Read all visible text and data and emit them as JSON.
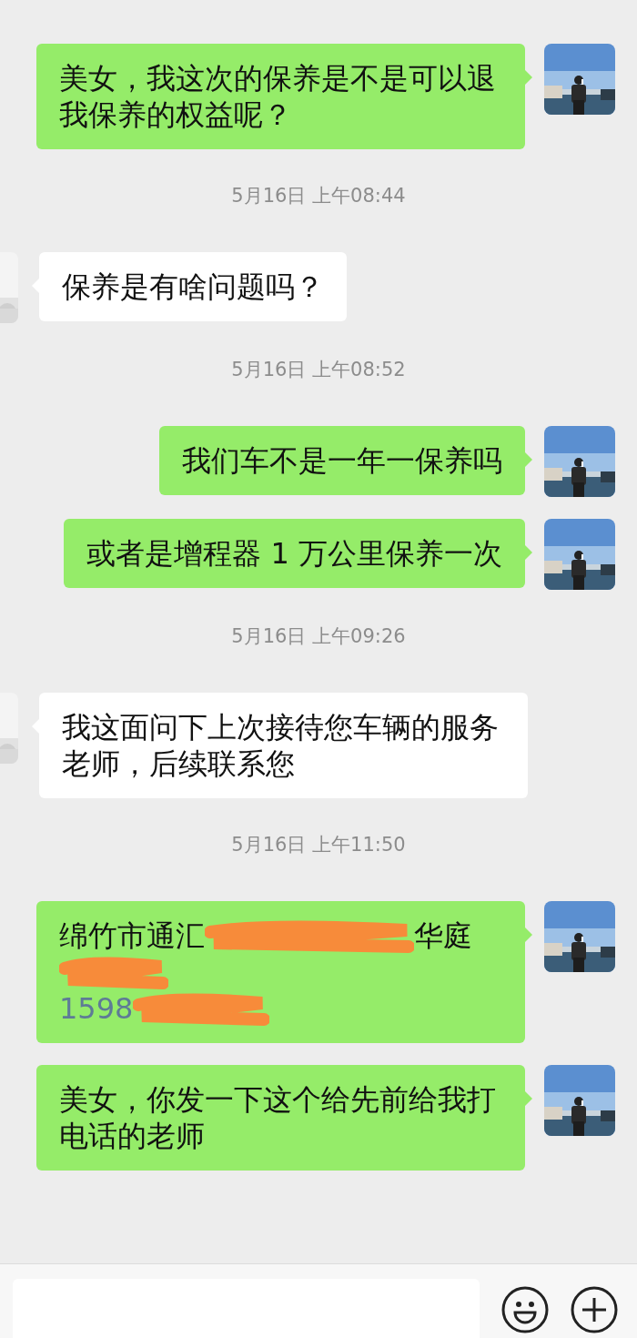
{
  "messages": [
    {
      "kind": "text",
      "outgoing": true,
      "text": "美女，我这次的保养是不是可以退我保养的权益呢？"
    },
    {
      "kind": "time",
      "text": "5月16日 上午08:44"
    },
    {
      "kind": "text",
      "outgoing": false,
      "text": "保养是有啥问题吗？"
    },
    {
      "kind": "time",
      "text": "5月16日 上午08:52"
    },
    {
      "kind": "text",
      "outgoing": true,
      "text": "我们车不是一年一保养吗"
    },
    {
      "kind": "text",
      "outgoing": true,
      "text": "或者是增程器 1 万公里保养一次"
    },
    {
      "kind": "time",
      "text": "5月16日 上午09:26"
    },
    {
      "kind": "text",
      "outgoing": false,
      "text": "我这面问下上次接待您车辆的服务老师，后续联系您"
    },
    {
      "kind": "time",
      "text": "5月16日 上午11:50"
    },
    {
      "kind": "redacted",
      "outgoing": true,
      "lines": [
        {
          "segments": [
            {
              "kind": "text",
              "text": "绵竹市通汇"
            },
            {
              "kind": "scribble"
            },
            {
              "kind": "text",
              "text": "华庭"
            }
          ]
        },
        {
          "segments": [
            {
              "kind": "scribble"
            }
          ]
        },
        {
          "segments": [
            {
              "kind": "phone",
              "text": "1598"
            },
            {
              "kind": "scribble"
            }
          ]
        }
      ]
    },
    {
      "kind": "text",
      "outgoing": true,
      "text": "美女，你发一下这个给先前给我打电话的老师"
    }
  ]
}
